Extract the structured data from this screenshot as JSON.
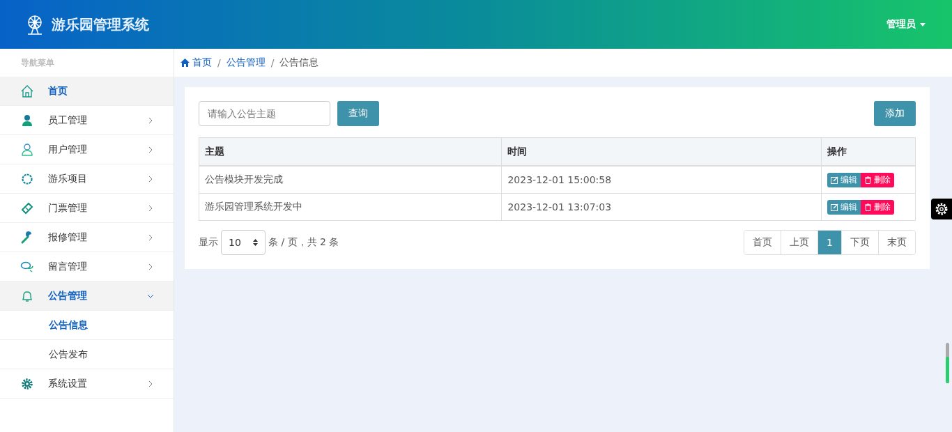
{
  "header": {
    "title": "游乐园管理系统",
    "user": "管理员"
  },
  "sidebar": {
    "heading": "导航菜单",
    "items": [
      {
        "label": "首页",
        "kind": "link",
        "selected": true
      },
      {
        "label": "员工管理",
        "kind": "menu",
        "selected": false,
        "expanded": false
      },
      {
        "label": "用户管理",
        "kind": "menu",
        "selected": false,
        "expanded": false
      },
      {
        "label": "游乐项目",
        "kind": "menu",
        "selected": false,
        "expanded": false
      },
      {
        "label": "门票管理",
        "kind": "menu",
        "selected": false,
        "expanded": false
      },
      {
        "label": "报修管理",
        "kind": "menu",
        "selected": false,
        "expanded": false
      },
      {
        "label": "留言管理",
        "kind": "menu",
        "selected": false,
        "expanded": false
      },
      {
        "label": "公告管理",
        "kind": "menu",
        "selected": true,
        "expanded": true,
        "children": [
          {
            "label": "公告信息",
            "selected": true
          },
          {
            "label": "公告发布",
            "selected": false
          }
        ]
      },
      {
        "label": "系统设置",
        "kind": "menu",
        "selected": false,
        "expanded": false
      }
    ]
  },
  "breadcrumb": {
    "separator": "/",
    "items": [
      {
        "label": "首页",
        "link": true
      },
      {
        "label": "公告管理",
        "link": true
      },
      {
        "label": "公告信息",
        "link": false
      }
    ]
  },
  "search": {
    "placeholder": "请输入公告主题",
    "button": "查询"
  },
  "add_button": "添加",
  "table": {
    "columns": [
      "主题",
      "时间",
      "操作"
    ],
    "rows": [
      {
        "cells": [
          "公告模块开发完成",
          "2023-12-01 15:00:58"
        ],
        "actions": [
          "编辑",
          "删除"
        ]
      },
      {
        "cells": [
          "游乐园管理系统开发中",
          "2023-12-01 13:07:03"
        ],
        "actions": [
          "编辑",
          "删除"
        ]
      }
    ]
  },
  "pagination": {
    "show_label": "显示",
    "page_size": "10",
    "summary": "条 / 页，共 2 条",
    "pages": [
      {
        "label": "首页",
        "selected": false
      },
      {
        "label": "上页",
        "selected": false
      },
      {
        "label": "1",
        "selected": true
      },
      {
        "label": "下页",
        "selected": false
      },
      {
        "label": "末页",
        "selected": false
      }
    ]
  }
}
